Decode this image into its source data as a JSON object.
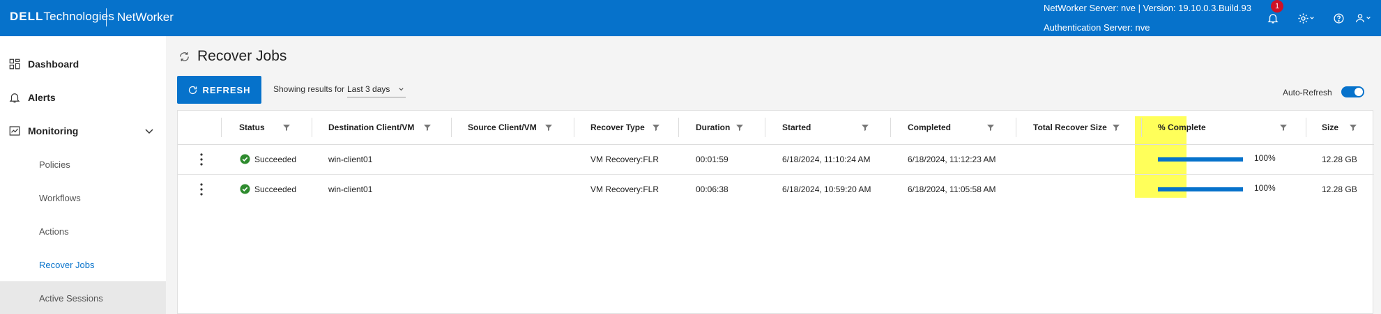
{
  "header": {
    "brand_part1": "DELL",
    "brand_part2": "Technologies",
    "product": "NetWorker",
    "server_line": "NetWorker Server: nve | Version: 19.10.0.3.Build.93",
    "auth_line": "Authentication Server: nve",
    "notification_count": "1",
    "icons": [
      "bell-icon",
      "gear-icon",
      "help-icon",
      "user-icon"
    ]
  },
  "sidebar": {
    "items": [
      {
        "label": "Dashboard",
        "icon": "dashboard-icon"
      },
      {
        "label": "Alerts",
        "icon": "bell-icon"
      },
      {
        "label": "Monitoring",
        "icon": "monitoring-icon",
        "expanded": true
      }
    ],
    "sub_items": [
      {
        "label": "Policies"
      },
      {
        "label": "Workflows"
      },
      {
        "label": "Actions"
      },
      {
        "label": "Recover Jobs",
        "active": true
      },
      {
        "label": "Active Sessions"
      }
    ]
  },
  "main": {
    "title": "Recover Jobs",
    "refresh_label": "REFRESH",
    "showing_label": "Showing results for",
    "range_value": "Last 3 days",
    "auto_refresh_label": "Auto-Refresh",
    "auto_refresh_on": true
  },
  "table": {
    "columns": [
      "Status",
      "Destination Client/VM",
      "Source Client/VM",
      "Recover Type",
      "Duration",
      "Started",
      "Completed",
      "Total Recover Size",
      "% Complete",
      "Size"
    ],
    "rows": [
      {
        "status": "Succeeded",
        "destination": "win-client01",
        "source": "",
        "type": "VM Recovery:FLR",
        "duration": "00:01:59",
        "started": "6/18/2024, 11:10:24 AM",
        "completed": "6/18/2024, 11:12:23 AM",
        "total_size": "",
        "percent": "100%",
        "progress": 1.0,
        "size": "12.28 GB"
      },
      {
        "status": "Succeeded",
        "destination": "win-client01",
        "source": "",
        "type": "VM Recovery:FLR",
        "duration": "00:06:38",
        "started": "6/18/2024, 10:59:20 AM",
        "completed": "6/18/2024, 11:05:58 AM",
        "total_size": "",
        "percent": "100%",
        "progress": 1.0,
        "size": "12.28 GB"
      }
    ]
  },
  "colors": {
    "accent": "#0672cb",
    "success": "#2e8b2e",
    "highlight": "#ffff5a",
    "badge": "#ce1126"
  }
}
